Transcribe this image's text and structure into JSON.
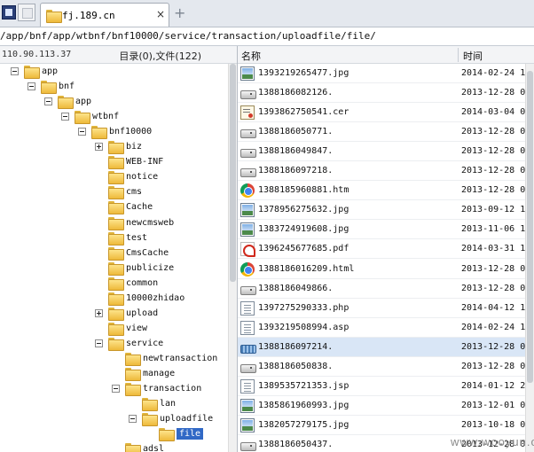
{
  "tabbar": {
    "active_tab_label": "fj.189.cn",
    "close_glyph": "×",
    "add_tab_glyph": "+"
  },
  "path_bar": {
    "path": "/app/bnf/app/wtbnf/bnf10000/service/transaction/uploadfile/file/"
  },
  "tree_panel": {
    "server_ip": "110.90.113.37",
    "dir_file_count": "目录(0),文件(122)",
    "nodes": [
      {
        "label": "app",
        "toggle": "minus"
      },
      {
        "label": "bnf",
        "toggle": "minus"
      },
      {
        "label": "app",
        "toggle": "minus"
      },
      {
        "label": "wtbnf",
        "toggle": "minus"
      },
      {
        "label": "bnf10000",
        "toggle": "minus"
      },
      {
        "label": "biz",
        "toggle": "plus"
      },
      {
        "label": "WEB-INF",
        "toggle": "none"
      },
      {
        "label": "notice",
        "toggle": "none"
      },
      {
        "label": "cms",
        "toggle": "none"
      },
      {
        "label": "Cache",
        "toggle": "none"
      },
      {
        "label": "newcmsweb",
        "toggle": "none"
      },
      {
        "label": "test",
        "toggle": "none"
      },
      {
        "label": "CmsCache",
        "toggle": "none"
      },
      {
        "label": "publicize",
        "toggle": "none"
      },
      {
        "label": "common",
        "toggle": "none"
      },
      {
        "label": "10000zhidao",
        "toggle": "none"
      },
      {
        "label": "upload",
        "toggle": "plus"
      },
      {
        "label": "view",
        "toggle": "none"
      },
      {
        "label": "service",
        "toggle": "minus"
      },
      {
        "label": "newtransaction",
        "toggle": "none"
      },
      {
        "label": "manage",
        "toggle": "none"
      },
      {
        "label": "transaction",
        "toggle": "minus"
      },
      {
        "label": "lan",
        "toggle": "none"
      },
      {
        "label": "uploadfile",
        "toggle": "minus"
      },
      {
        "label": "file",
        "toggle": "none",
        "selected": true
      },
      {
        "label": "adsl",
        "toggle": "none"
      }
    ]
  },
  "file_list": {
    "columns": {
      "name": "名称",
      "time": "时间"
    },
    "rows": [
      {
        "name": "1393219265477.jpg",
        "time": "2014-02-24 13",
        "icon": "image-icon"
      },
      {
        "name": "1388186082126.",
        "time": "2013-12-28 07",
        "icon": "drive-icon"
      },
      {
        "name": "1393862750541.cer",
        "time": "2014-03-04 00",
        "icon": "certificate-icon"
      },
      {
        "name": "1388186050771.",
        "time": "2013-12-28 07",
        "icon": "drive-icon"
      },
      {
        "name": "1388186049847.",
        "time": "2013-12-28 07",
        "icon": "drive-icon"
      },
      {
        "name": "1388186097218.",
        "time": "2013-12-28 07",
        "icon": "drive-icon"
      },
      {
        "name": "1388185960881.htm",
        "time": "2013-12-28 07",
        "icon": "chrome-icon"
      },
      {
        "name": "1378956275632.jpg",
        "time": "2013-09-12 11",
        "icon": "image-icon"
      },
      {
        "name": "1383724919608.jpg",
        "time": "2013-11-06 16",
        "icon": "image-icon"
      },
      {
        "name": "1396245677685.pdf",
        "time": "2014-03-31 14",
        "icon": "pdf-icon"
      },
      {
        "name": "1388186016209.html",
        "time": "2013-12-28 07",
        "icon": "chrome-icon"
      },
      {
        "name": "1388186049866.",
        "time": "2013-12-28 07",
        "icon": "drive-icon"
      },
      {
        "name": "1397275290333.php",
        "time": "2014-04-12 13",
        "icon": "text-file-icon"
      },
      {
        "name": "1393219508994.asp",
        "time": "2014-02-24 13",
        "icon": "text-file-icon"
      },
      {
        "name": "1388186097214.",
        "time": "2013-12-28 07",
        "icon": "partial-file-icon",
        "highlight": true
      },
      {
        "name": "1388186050838.",
        "time": "2013-12-28 07",
        "icon": "drive-icon"
      },
      {
        "name": "1389535721353.jsp",
        "time": "2014-01-12 22",
        "icon": "text-file-icon"
      },
      {
        "name": "1385861960993.jpg",
        "time": "2013-12-01 09",
        "icon": "image-icon"
      },
      {
        "name": "1382057279175.jpg",
        "time": "2013-10-18 08",
        "icon": "image-icon"
      },
      {
        "name": "1388186050437.",
        "time": "2013-12-28 07",
        "icon": "drive-icon"
      }
    ]
  },
  "watermark": "www.wooyun.org"
}
